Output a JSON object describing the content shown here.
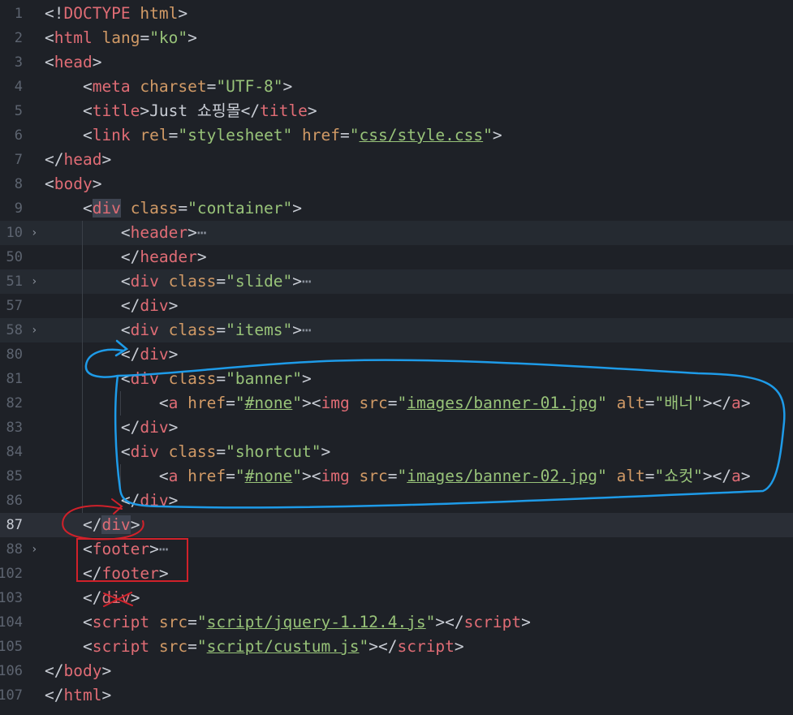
{
  "lines": [
    {
      "n": "1",
      "code": [
        [
          "p",
          "<!"
        ],
        [
          "t",
          "DOCTYPE"
        ],
        [
          "p",
          " "
        ],
        [
          "a",
          "html"
        ],
        [
          "p",
          ">"
        ]
      ]
    },
    {
      "n": "2",
      "code": [
        [
          "p",
          "<"
        ],
        [
          "t",
          "html"
        ],
        [
          "p",
          " "
        ],
        [
          "a",
          "lang"
        ],
        [
          "p",
          "="
        ],
        [
          "s",
          "\"ko\""
        ],
        [
          "p",
          ">"
        ]
      ]
    },
    {
      "n": "3",
      "code": [
        [
          "p",
          "<"
        ],
        [
          "t",
          "head"
        ],
        [
          "p",
          ">"
        ]
      ]
    },
    {
      "n": "4",
      "code": [
        [
          "p",
          "    <"
        ],
        [
          "t",
          "meta"
        ],
        [
          "p",
          " "
        ],
        [
          "a",
          "charset"
        ],
        [
          "p",
          "="
        ],
        [
          "s",
          "\"UTF-8\""
        ],
        [
          "p",
          ">"
        ]
      ]
    },
    {
      "n": "5",
      "code": [
        [
          "p",
          "    <"
        ],
        [
          "t",
          "title"
        ],
        [
          "p",
          ">Just 쇼핑몰</"
        ],
        [
          "t",
          "title"
        ],
        [
          "p",
          ">"
        ]
      ]
    },
    {
      "n": "6",
      "code": [
        [
          "p",
          "    <"
        ],
        [
          "t",
          "link"
        ],
        [
          "p",
          " "
        ],
        [
          "a",
          "rel"
        ],
        [
          "p",
          "="
        ],
        [
          "s",
          "\"stylesheet\""
        ],
        [
          "p",
          " "
        ],
        [
          "a",
          "href"
        ],
        [
          "p",
          "="
        ],
        [
          "s",
          "\""
        ],
        [
          "su",
          "css/style.css"
        ],
        [
          "s",
          "\""
        ],
        [
          "p",
          ">"
        ]
      ]
    },
    {
      "n": "7",
      "code": [
        [
          "p",
          "</"
        ],
        [
          "t",
          "head"
        ],
        [
          "p",
          ">"
        ]
      ]
    },
    {
      "n": "8",
      "code": [
        [
          "p",
          "<"
        ],
        [
          "t",
          "body"
        ],
        [
          "p",
          ">"
        ]
      ]
    },
    {
      "n": "9",
      "code": [
        [
          "p",
          "    <"
        ],
        [
          "tm",
          "div"
        ],
        [
          "p",
          " "
        ],
        [
          "a",
          "class"
        ],
        [
          "p",
          "="
        ],
        [
          "s",
          "\"container\""
        ],
        [
          "p",
          ">"
        ]
      ]
    },
    {
      "n": "10",
      "fold": true,
      "folded": true,
      "code": [
        [
          "p",
          "        <"
        ],
        [
          "t",
          "header"
        ],
        [
          "p",
          ">"
        ],
        [
          "e",
          "⋯"
        ]
      ]
    },
    {
      "n": "50",
      "code": [
        [
          "p",
          "        </"
        ],
        [
          "t",
          "header"
        ],
        [
          "p",
          ">"
        ]
      ]
    },
    {
      "n": "51",
      "fold": true,
      "folded": true,
      "code": [
        [
          "p",
          "        <"
        ],
        [
          "t",
          "div"
        ],
        [
          "p",
          " "
        ],
        [
          "a",
          "class"
        ],
        [
          "p",
          "="
        ],
        [
          "s",
          "\"slide\""
        ],
        [
          "p",
          ">"
        ],
        [
          "e",
          "⋯"
        ]
      ]
    },
    {
      "n": "57",
      "code": [
        [
          "p",
          "        </"
        ],
        [
          "t",
          "div"
        ],
        [
          "p",
          ">"
        ]
      ]
    },
    {
      "n": "58",
      "fold": true,
      "folded": true,
      "code": [
        [
          "p",
          "        <"
        ],
        [
          "t",
          "div"
        ],
        [
          "p",
          " "
        ],
        [
          "a",
          "class"
        ],
        [
          "p",
          "="
        ],
        [
          "s",
          "\"items\""
        ],
        [
          "p",
          ">"
        ],
        [
          "e",
          "⋯"
        ]
      ]
    },
    {
      "n": "80",
      "code": [
        [
          "p",
          "        </"
        ],
        [
          "t",
          "div"
        ],
        [
          "p",
          ">"
        ]
      ]
    },
    {
      "n": "81",
      "code": [
        [
          "p",
          "        <"
        ],
        [
          "t",
          "div"
        ],
        [
          "p",
          " "
        ],
        [
          "a",
          "class"
        ],
        [
          "p",
          "="
        ],
        [
          "s",
          "\"banner\""
        ],
        [
          "p",
          ">"
        ]
      ]
    },
    {
      "n": "82",
      "code": [
        [
          "p",
          "            <"
        ],
        [
          "t",
          "a"
        ],
        [
          "p",
          " "
        ],
        [
          "a",
          "href"
        ],
        [
          "p",
          "="
        ],
        [
          "s",
          "\""
        ],
        [
          "su",
          "#none"
        ],
        [
          "s",
          "\""
        ],
        [
          "p",
          "><"
        ],
        [
          "t",
          "img"
        ],
        [
          "p",
          " "
        ],
        [
          "a",
          "src"
        ],
        [
          "p",
          "="
        ],
        [
          "s",
          "\""
        ],
        [
          "su",
          "images/banner-01.jpg"
        ],
        [
          "s",
          "\""
        ],
        [
          "p",
          " "
        ],
        [
          "a",
          "alt"
        ],
        [
          "p",
          "="
        ],
        [
          "s",
          "\"배너\""
        ],
        [
          "p",
          "></"
        ],
        [
          "t",
          "a"
        ],
        [
          "p",
          ">"
        ]
      ]
    },
    {
      "n": "83",
      "code": [
        [
          "p",
          "        </"
        ],
        [
          "t",
          "div"
        ],
        [
          "p",
          ">"
        ]
      ]
    },
    {
      "n": "84",
      "code": [
        [
          "p",
          "        <"
        ],
        [
          "t",
          "div"
        ],
        [
          "p",
          " "
        ],
        [
          "a",
          "class"
        ],
        [
          "p",
          "="
        ],
        [
          "s",
          "\"shortcut\""
        ],
        [
          "p",
          ">"
        ]
      ]
    },
    {
      "n": "85",
      "code": [
        [
          "p",
          "            <"
        ],
        [
          "t",
          "a"
        ],
        [
          "p",
          " "
        ],
        [
          "a",
          "href"
        ],
        [
          "p",
          "="
        ],
        [
          "s",
          "\""
        ],
        [
          "su",
          "#none"
        ],
        [
          "s",
          "\""
        ],
        [
          "p",
          "><"
        ],
        [
          "t",
          "img"
        ],
        [
          "p",
          " "
        ],
        [
          "a",
          "src"
        ],
        [
          "p",
          "="
        ],
        [
          "s",
          "\""
        ],
        [
          "su",
          "images/banner-02.jpg"
        ],
        [
          "s",
          "\""
        ],
        [
          "p",
          " "
        ],
        [
          "a",
          "alt"
        ],
        [
          "p",
          "="
        ],
        [
          "s",
          "\"쇼컷\""
        ],
        [
          "p",
          "></"
        ],
        [
          "t",
          "a"
        ],
        [
          "p",
          ">"
        ]
      ]
    },
    {
      "n": "86",
      "code": [
        [
          "p",
          "        </"
        ],
        [
          "t",
          "div"
        ],
        [
          "p",
          ">"
        ]
      ]
    },
    {
      "n": "87",
      "current": true,
      "code": [
        [
          "p",
          "    </"
        ],
        [
          "tm",
          "div"
        ],
        [
          "p",
          ">"
        ]
      ]
    },
    {
      "n": "88",
      "fold": true,
      "code": [
        [
          "p",
          "    <"
        ],
        [
          "t",
          "footer"
        ],
        [
          "p",
          ">"
        ],
        [
          "e",
          "⋯"
        ]
      ]
    },
    {
      "n": "102",
      "code": [
        [
          "p",
          "    </"
        ],
        [
          "t",
          "footer"
        ],
        [
          "p",
          ">"
        ]
      ]
    },
    {
      "n": "103",
      "code": [
        [
          "p",
          "    </"
        ],
        [
          "t",
          "div"
        ],
        [
          "p",
          ">"
        ]
      ]
    },
    {
      "n": "104",
      "code": [
        [
          "p",
          "    <"
        ],
        [
          "t",
          "script"
        ],
        [
          "p",
          " "
        ],
        [
          "a",
          "src"
        ],
        [
          "p",
          "="
        ],
        [
          "s",
          "\""
        ],
        [
          "su",
          "script/jquery-1.12.4.js"
        ],
        [
          "s",
          "\""
        ],
        [
          "p",
          "></"
        ],
        [
          "t",
          "script"
        ],
        [
          "p",
          ">"
        ]
      ]
    },
    {
      "n": "105",
      "code": [
        [
          "p",
          "    <"
        ],
        [
          "t",
          "script"
        ],
        [
          "p",
          " "
        ],
        [
          "a",
          "src"
        ],
        [
          "p",
          "="
        ],
        [
          "s",
          "\""
        ],
        [
          "su",
          "script/custum.js"
        ],
        [
          "s",
          "\""
        ],
        [
          "p",
          "></"
        ],
        [
          "t",
          "script"
        ],
        [
          "p",
          ">"
        ]
      ]
    },
    {
      "n": "106",
      "code": [
        [
          "p",
          "</"
        ],
        [
          "t",
          "body"
        ],
        [
          "p",
          ">"
        ]
      ]
    },
    {
      "n": "107",
      "code": [
        [
          "p",
          "</"
        ],
        [
          "t",
          "html"
        ],
        [
          "p",
          ">"
        ]
      ]
    }
  ],
  "colors": {
    "tag": "#e06c75",
    "attribute": "#d19a66",
    "string": "#98c379",
    "punctuation": "#c8ccd4",
    "annotation_blue": "#1e9be8",
    "annotation_red": "#d0212a"
  }
}
